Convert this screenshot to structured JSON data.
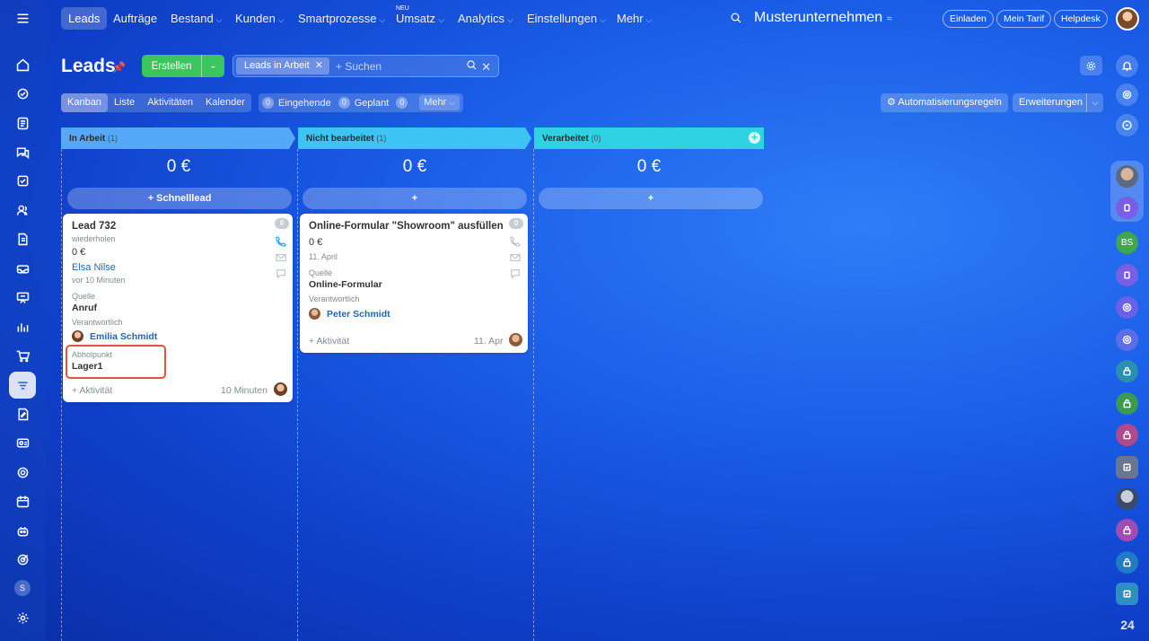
{
  "topnav": {
    "items": [
      {
        "label": "Leads",
        "active": true
      },
      {
        "label": "Aufträge"
      },
      {
        "label": "Bestand"
      },
      {
        "label": "Kunden"
      },
      {
        "label": "Smartprozesse"
      },
      {
        "label": "Umsatz"
      },
      {
        "label": "Analytics"
      },
      {
        "label": "Einstellungen"
      },
      {
        "label": "Mehr"
      }
    ],
    "new_badge": "NEU",
    "company": "Musterunternehmen",
    "invite": "Einladen",
    "plan": "Mein Tarif",
    "helpdesk": "Helpdesk"
  },
  "header": {
    "title": "Leads",
    "create": "Erstellen",
    "filter_chip": "Leads in Arbeit",
    "search_placeholder": "+ Suchen"
  },
  "views": {
    "tabs": [
      "Kanban",
      "Liste",
      "Aktivitäten",
      "Kalender"
    ],
    "active": "Kanban",
    "counters": [
      {
        "count": "0",
        "label": "Eingehende"
      },
      {
        "count": "0",
        "label": "Geplant"
      },
      {
        "count": "0",
        "label": "Mehr"
      }
    ],
    "automation": "Automatisierungsregeln",
    "extensions": "Erweiterungen"
  },
  "columns": [
    {
      "name": "In Arbeit",
      "count": "(1)",
      "sum": "0 €",
      "add_label": "+ Schnelllead",
      "color": "#55a8f7"
    },
    {
      "name": "Nicht bearbeitet",
      "count": "(1)",
      "sum": "0 €",
      "add_label": "+",
      "color": "#3ec3f5"
    },
    {
      "name": "Verarbeitet",
      "count": "(0)",
      "sum": "0 €",
      "add_label": "+",
      "color": "#2fd2e0"
    }
  ],
  "cards": [
    {
      "title": "Lead 732",
      "subtitle": "wiederholen",
      "amount": "0 €",
      "contact": "Elsa Nilse",
      "time": "vor 10 Minuten",
      "source_label": "Quelle",
      "source": "Anruf",
      "resp_label": "Verantwortlich",
      "resp": "Emilia Schmidt",
      "pickup_label": "Abholpunkt",
      "pickup": "Lager1",
      "activity": "+ Aktivität",
      "foot_time": "10 Minuten",
      "badge": "0"
    },
    {
      "title": "Online-Formular \"Showroom\" ausfüllen",
      "amount": "0 €",
      "date": "11. April",
      "source_label": "Quelle",
      "source": "Online-Formular",
      "resp_label": "Verantwortlich",
      "resp": "Peter Schmidt",
      "activity": "+ Aktivität",
      "foot_time": "11. Apr",
      "badge": "0"
    }
  ],
  "right_bar": {
    "bs": "BS",
    "logo": "24"
  },
  "left_bar": {
    "s": "S"
  }
}
